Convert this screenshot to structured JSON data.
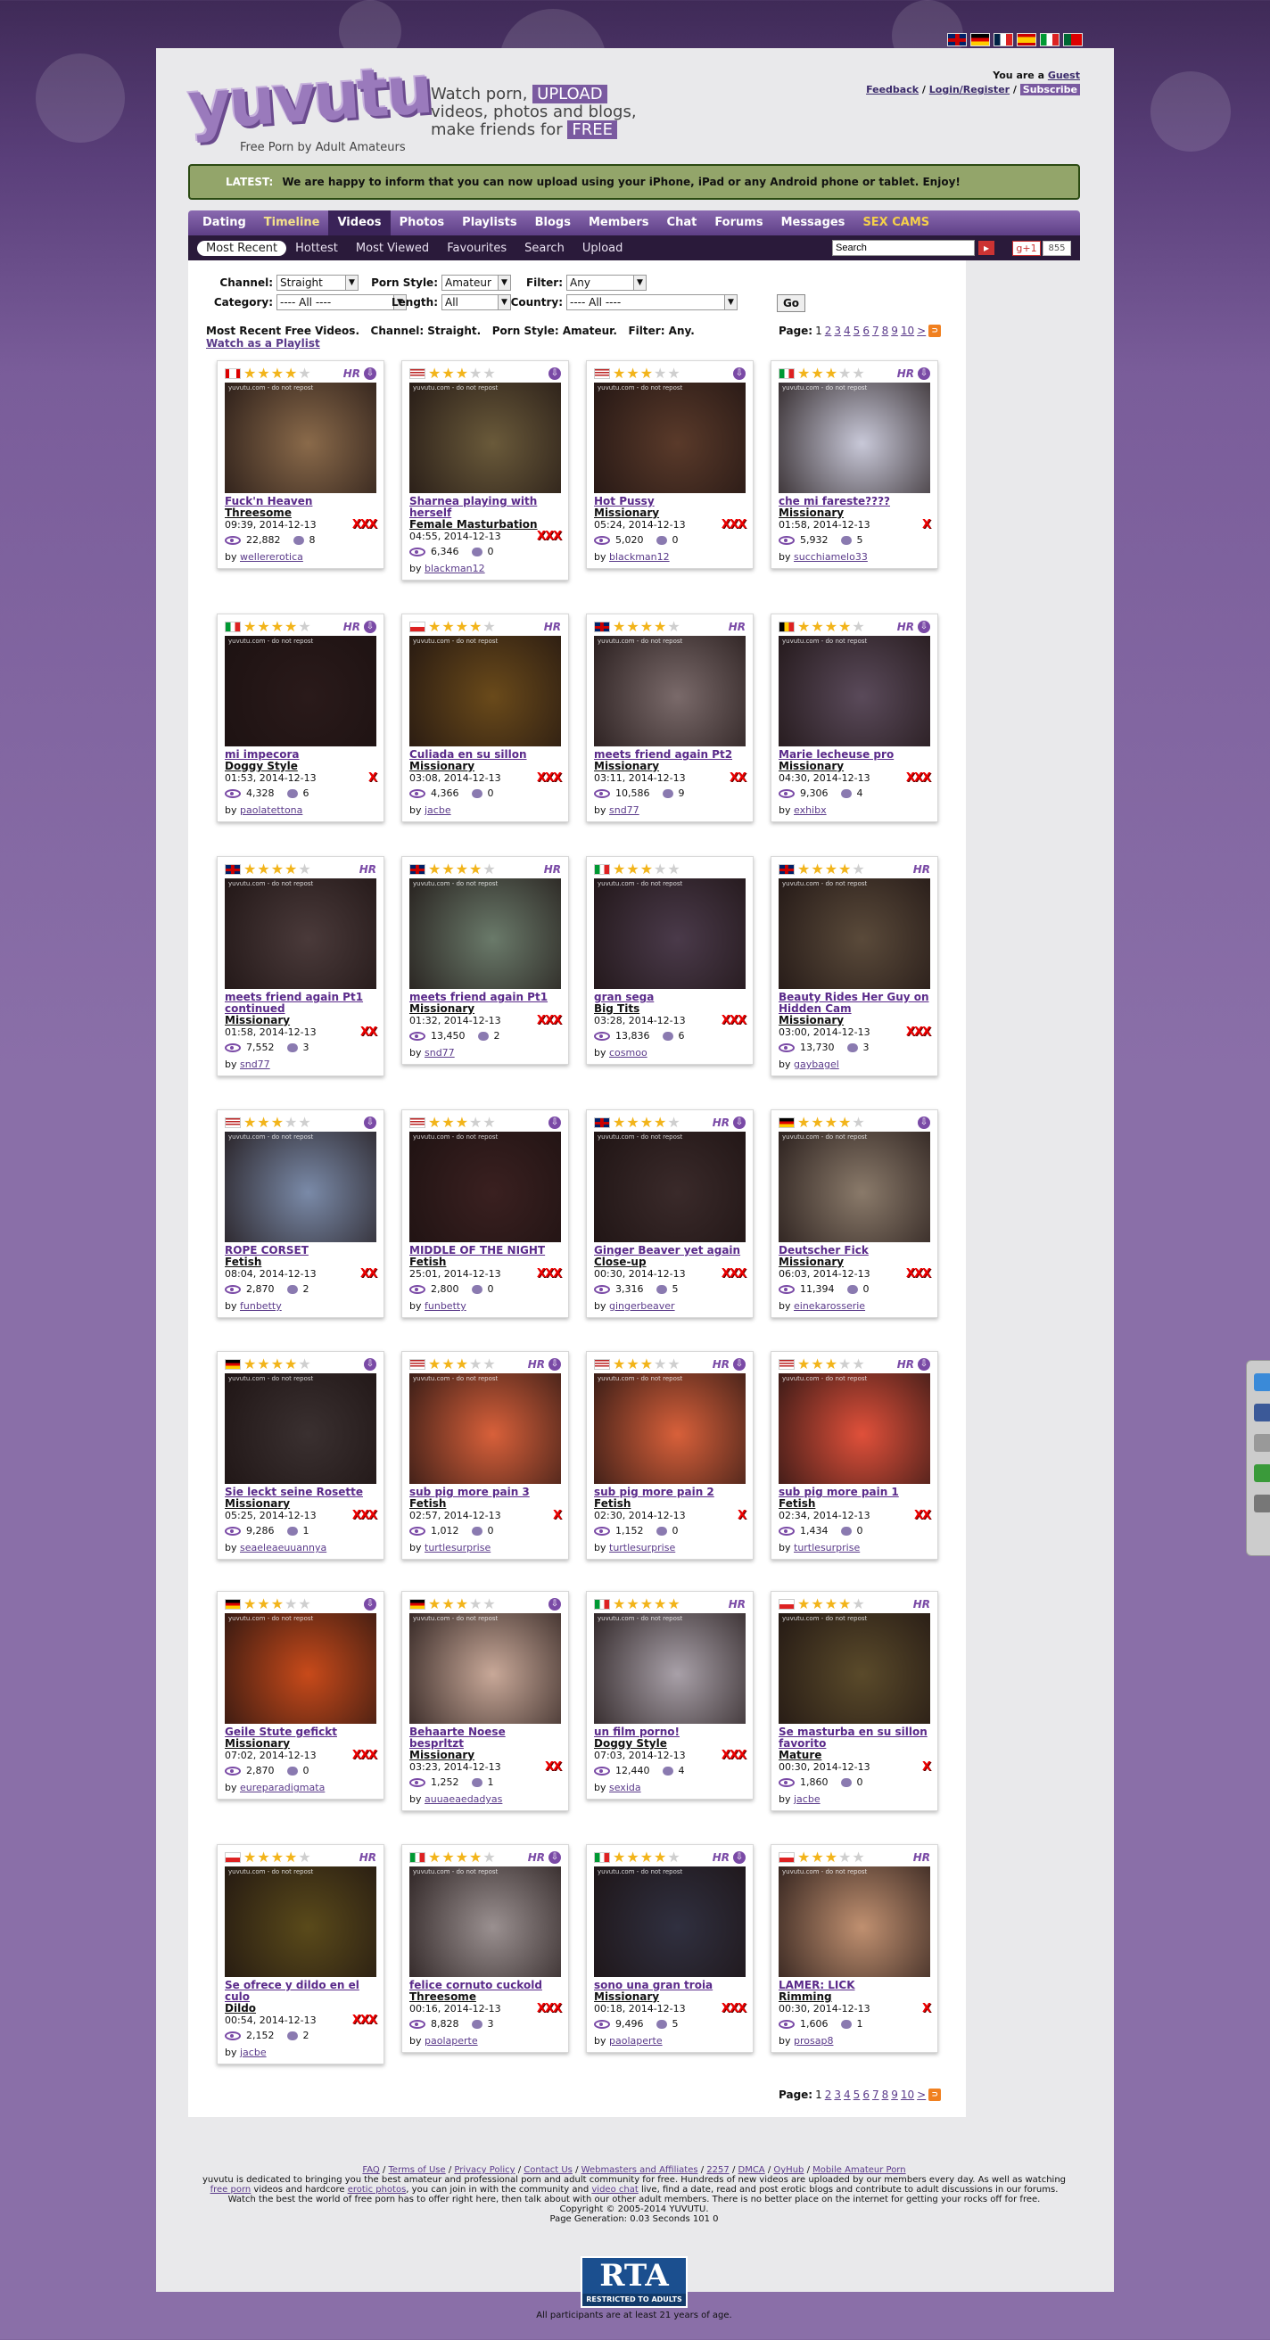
{
  "site": {
    "logo_text": "yuvutu",
    "logo_tagline": "Free Porn by Adult Amateurs",
    "tagline_parts": [
      "Watch porn, ",
      "UPLOAD",
      " videos, photos and blogs, make friends for ",
      "FREE"
    ],
    "user_status": "You are a ",
    "user_role": "Guest",
    "feedback": "Feedback",
    "login": "Login/Register",
    "subscribe": "Subscribe",
    "sep": " / "
  },
  "flags": [
    "gb",
    "de",
    "fr",
    "es",
    "it",
    "pt"
  ],
  "latest": {
    "label": "LATEST:",
    "text": "We are happy to inform that you can now upload using your iPhone, iPad or any Android phone or tablet. Enjoy!"
  },
  "nav": {
    "items": [
      "Dating",
      "Timeline",
      "Videos",
      "Photos",
      "Playlists",
      "Blogs",
      "Members",
      "Chat",
      "Forums",
      "Messages",
      "SEX CAMS"
    ],
    "active": "Videos"
  },
  "subnav": {
    "items": [
      "Most Recent",
      "Hottest",
      "Most Viewed",
      "Favourites",
      "Search",
      "Upload"
    ],
    "active": "Most Recent",
    "search_value": "Search",
    "gplus": "g+1",
    "gcount": "855"
  },
  "filters": {
    "channel_label": "Channel:",
    "channel_value": "Straight",
    "porn_style_label": "Porn Style:",
    "porn_style_value": "Amateur",
    "filter_label": "Filter:",
    "filter_value": "Any",
    "category_label": "Category:",
    "category_value": "---- All ----",
    "length_label": "Length:",
    "length_value": "All",
    "country_label": "Country:",
    "country_value": "---- All ----",
    "go": "Go"
  },
  "info": {
    "line": "Most Recent Free Videos.   Channel: Straight.   Porn Style: Amateur.   Filter: Any.",
    "playlist": "Watch as a Playlist"
  },
  "pager": {
    "label": "Page:",
    "current": "1",
    "pages": [
      "2",
      "3",
      "4",
      "5",
      "6",
      "7",
      "8",
      "9",
      "10",
      ">"
    ]
  },
  "colors": {
    "accent": "#7a5aa0",
    "latest_bg": "#93a56a",
    "xxx": "#e00000"
  },
  "videos": [
    {
      "title": "Fuck'n Heaven",
      "cat": "Threesome",
      "meta": "09:39, 2014-12-13",
      "xxx": "XXX",
      "views": "22,882",
      "comments": "8",
      "user": "wellererotica",
      "flag": "ca",
      "stars": 4,
      "hr": true,
      "dl": true
    },
    {
      "title": "Sharnea playing with herself",
      "cat": "Female Masturbation",
      "meta": "04:55, 2014-12-13",
      "xxx": "XXX",
      "views": "6,346",
      "comments": "0",
      "user": "blackman12",
      "flag": "us",
      "stars": 3,
      "hr": false,
      "dl": true
    },
    {
      "title": "Hot Pussy",
      "cat": "Missionary",
      "meta": "05:24, 2014-12-13",
      "xxx": "XXX",
      "views": "5,020",
      "comments": "0",
      "user": "blackman12",
      "flag": "us",
      "stars": 3,
      "hr": false,
      "dl": true
    },
    {
      "title": "che mi fareste????",
      "cat": "Missionary",
      "meta": "01:58, 2014-12-13",
      "xxx": "X",
      "views": "5,932",
      "comments": "5",
      "user": "succhiamelo33",
      "flag": "it",
      "stars": 3,
      "hr": true,
      "dl": true
    },
    {
      "title": "mi impecora",
      "cat": "Doggy Style",
      "meta": "01:53, 2014-12-13",
      "xxx": "X",
      "views": "4,328",
      "comments": "6",
      "user": "paolatettona",
      "flag": "it",
      "stars": 4,
      "hr": true,
      "dl": true
    },
    {
      "title": "Culiada en su sillon",
      "cat": "Missionary",
      "meta": "03:08, 2014-12-13",
      "xxx": "XXX",
      "views": "4,366",
      "comments": "0",
      "user": "jacbe",
      "flag": "cl",
      "stars": 4,
      "hr": true,
      "dl": false
    },
    {
      "title": "meets friend again Pt2",
      "cat": "Missionary",
      "meta": "03:11, 2014-12-13",
      "xxx": "XX",
      "views": "10,586",
      "comments": "9",
      "user": "snd77",
      "flag": "gb",
      "stars": 4,
      "hr": true,
      "dl": false
    },
    {
      "title": "Marie lecheuse pro",
      "cat": "Missionary",
      "meta": "04:30, 2014-12-13",
      "xxx": "XXX",
      "views": "9,306",
      "comments": "4",
      "user": "exhibx",
      "flag": "be",
      "stars": 4,
      "hr": true,
      "dl": true
    },
    {
      "title": "meets friend again Pt1 continued",
      "cat": "Missionary",
      "meta": "01:58, 2014-12-13",
      "xxx": "XX",
      "views": "7,552",
      "comments": "3",
      "user": "snd77",
      "flag": "gb",
      "stars": 4,
      "hr": true,
      "dl": false
    },
    {
      "title": "meets friend again Pt1",
      "cat": "Missionary",
      "meta": "01:32, 2014-12-13",
      "xxx": "XXX",
      "views": "13,450",
      "comments": "2",
      "user": "snd77",
      "flag": "gb",
      "stars": 4,
      "hr": true,
      "dl": false
    },
    {
      "title": "gran sega",
      "cat": "Big Tits",
      "meta": "03:28, 2014-12-13",
      "xxx": "XXX",
      "views": "13,836",
      "comments": "6",
      "user": "cosmoo",
      "flag": "it",
      "stars": 3,
      "hr": false,
      "dl": false
    },
    {
      "title": "Beauty Rides Her Guy on Hidden Cam",
      "cat": "Missionary",
      "meta": "03:00, 2014-12-13",
      "xxx": "XXX",
      "views": "13,730",
      "comments": "3",
      "user": "gaybagel",
      "flag": "gb",
      "stars": 4,
      "hr": true,
      "dl": false
    },
    {
      "title": "ROPE CORSET",
      "cat": "Fetish",
      "meta": "08:04, 2014-12-13",
      "xxx": "XX",
      "views": "2,870",
      "comments": "2",
      "user": "funbetty",
      "flag": "us",
      "stars": 3,
      "hr": false,
      "dl": true
    },
    {
      "title": "MIDDLE OF THE NIGHT",
      "cat": "Fetish",
      "meta": "25:01, 2014-12-13",
      "xxx": "XXX",
      "views": "2,800",
      "comments": "0",
      "user": "funbetty",
      "flag": "us",
      "stars": 3,
      "hr": false,
      "dl": true
    },
    {
      "title": "Ginger Beaver yet again",
      "cat": "Close-up",
      "meta": "00:30, 2014-12-13",
      "xxx": "XXX",
      "views": "3,316",
      "comments": "5",
      "user": "gingerbeaver",
      "flag": "gb",
      "stars": 4,
      "hr": true,
      "dl": true
    },
    {
      "title": "Deutscher Fick",
      "cat": "Missionary",
      "meta": "06:03, 2014-12-13",
      "xxx": "XXX",
      "views": "11,394",
      "comments": "0",
      "user": "einekarosserie",
      "flag": "de",
      "stars": 4,
      "hr": false,
      "dl": true
    },
    {
      "title": "Sie leckt seine Rosette",
      "cat": "Missionary",
      "meta": "05:25, 2014-12-13",
      "xxx": "XXX",
      "views": "9,286",
      "comments": "1",
      "user": "seaeleaeuuannya",
      "flag": "de",
      "stars": 4,
      "hr": false,
      "dl": true
    },
    {
      "title": "sub pig more pain 3",
      "cat": "Fetish",
      "meta": "02:57, 2014-12-13",
      "xxx": "X",
      "views": "1,012",
      "comments": "0",
      "user": "turtlesurprise",
      "flag": "us",
      "stars": 3,
      "hr": true,
      "dl": true
    },
    {
      "title": "sub pig more pain 2",
      "cat": "Fetish",
      "meta": "02:30, 2014-12-13",
      "xxx": "X",
      "views": "1,152",
      "comments": "0",
      "user": "turtlesurprise",
      "flag": "us",
      "stars": 3,
      "hr": true,
      "dl": true
    },
    {
      "title": "sub pig more pain 1",
      "cat": "Fetish",
      "meta": "02:34, 2014-12-13",
      "xxx": "XX",
      "views": "1,434",
      "comments": "0",
      "user": "turtlesurprise",
      "flag": "us",
      "stars": 3,
      "hr": true,
      "dl": true
    },
    {
      "title": "Geile Stute gefickt",
      "cat": "Missionary",
      "meta": "07:02, 2014-12-13",
      "xxx": "XXX",
      "views": "2,870",
      "comments": "0",
      "user": "eureparadigmata",
      "flag": "de",
      "stars": 3,
      "hr": false,
      "dl": true
    },
    {
      "title": "Behaarte Noese besprltzt",
      "cat": "Missionary",
      "meta": "03:23, 2014-12-13",
      "xxx": "XX",
      "views": "1,252",
      "comments": "1",
      "user": "auuaeaedadyas",
      "flag": "de",
      "stars": 3,
      "hr": false,
      "dl": true
    },
    {
      "title": "un film porno!",
      "cat": "Doggy Style",
      "meta": "07:03, 2014-12-13",
      "xxx": "XXX",
      "views": "12,440",
      "comments": "4",
      "user": "sexida",
      "flag": "it",
      "stars": 5,
      "hr": true,
      "dl": false
    },
    {
      "title": "Se masturba en su sillon favorito",
      "cat": "Mature",
      "meta": "00:30, 2014-12-13",
      "xxx": "X",
      "views": "1,860",
      "comments": "0",
      "user": "jacbe",
      "flag": "cl",
      "stars": 4,
      "hr": true,
      "dl": false
    },
    {
      "title": "Se ofrece y dildo en el culo",
      "cat": "Dildo",
      "meta": "00:54, 2014-12-13",
      "xxx": "XXX",
      "views": "2,152",
      "comments": "2",
      "user": "jacbe",
      "flag": "cl",
      "stars": 4,
      "hr": true,
      "dl": false
    },
    {
      "title": "felice cornuto cuckold",
      "cat": "Threesome",
      "meta": "00:16, 2014-12-13",
      "xxx": "XXX",
      "views": "8,828",
      "comments": "3",
      "user": "paolaperte",
      "flag": "it",
      "stars": 4,
      "hr": true,
      "dl": true
    },
    {
      "title": "sono una gran troia",
      "cat": "Missionary",
      "meta": "00:18, 2014-12-13",
      "xxx": "XXX",
      "views": "9,496",
      "comments": "5",
      "user": "paolaperte",
      "flag": "it",
      "stars": 4,
      "hr": true,
      "dl": true
    },
    {
      "title": "LAMER: LICK",
      "cat": "Rimming",
      "meta": "00:30, 2014-12-13",
      "xxx": "X",
      "views": "1,606",
      "comments": "1",
      "user": "prosap8",
      "flag": "cl",
      "stars": 3,
      "hr": true,
      "dl": false
    }
  ],
  "thumb_colors": [
    "#8a6a4a",
    "#6a5a3a",
    "#5a3a2a",
    "#c8c8d8",
    "#2a1a1a",
    "#6a4a1a",
    "#7a6a6a",
    "#5a4a5a",
    "#4a3a3a",
    "#6a7a6a",
    "#4a3a4a",
    "#5a4a3a",
    "#7a8aa8",
    "#3a2020",
    "#3a2a2a",
    "#8a7a6a",
    "#3a3030",
    "#d8603a",
    "#d8603a",
    "#e0503a",
    "#c84a1a",
    "#c8a898",
    "#a8a0a8",
    "#5a4a2a",
    "#5a4a1a",
    "#9a9090",
    "#303040",
    "#c09070"
  ],
  "footer": {
    "links": [
      "FAQ",
      "Terms of Use",
      "Privacy Policy",
      "Contact Us",
      "Webmasters and Affiliates",
      "2257",
      "DMCA",
      "OyHub",
      "Mobile Amateur Porn"
    ],
    "text1": "yuvutu is dedicated to bringing you the best amateur and professional porn and adult community for free. Hundreds of new videos are uploaded by our members every day. As well as watching ",
    "link_free_porn": "free porn",
    "text2": " videos and hardcore ",
    "link_erotic_photos": "erotic photos",
    "text3": ", you can join in with the community and ",
    "link_video_chat": "video chat",
    "text4": " live, find a date, read and post erotic blogs and contribute to adult discussions in our forums. Watch the best the world of free porn has to offer right here, then talk about with our other adult members. There is no better place on the internet for getting your rocks off for free.",
    "copyright": "Copyright © 2005-2014 YUVUTU.",
    "generation": "Page Generation: 0.03 Seconds 101 0",
    "rta_big": "RTA",
    "rta_small": "RESTRICTED TO ADULTS",
    "adults": "All participants are at least 21 years of age."
  }
}
